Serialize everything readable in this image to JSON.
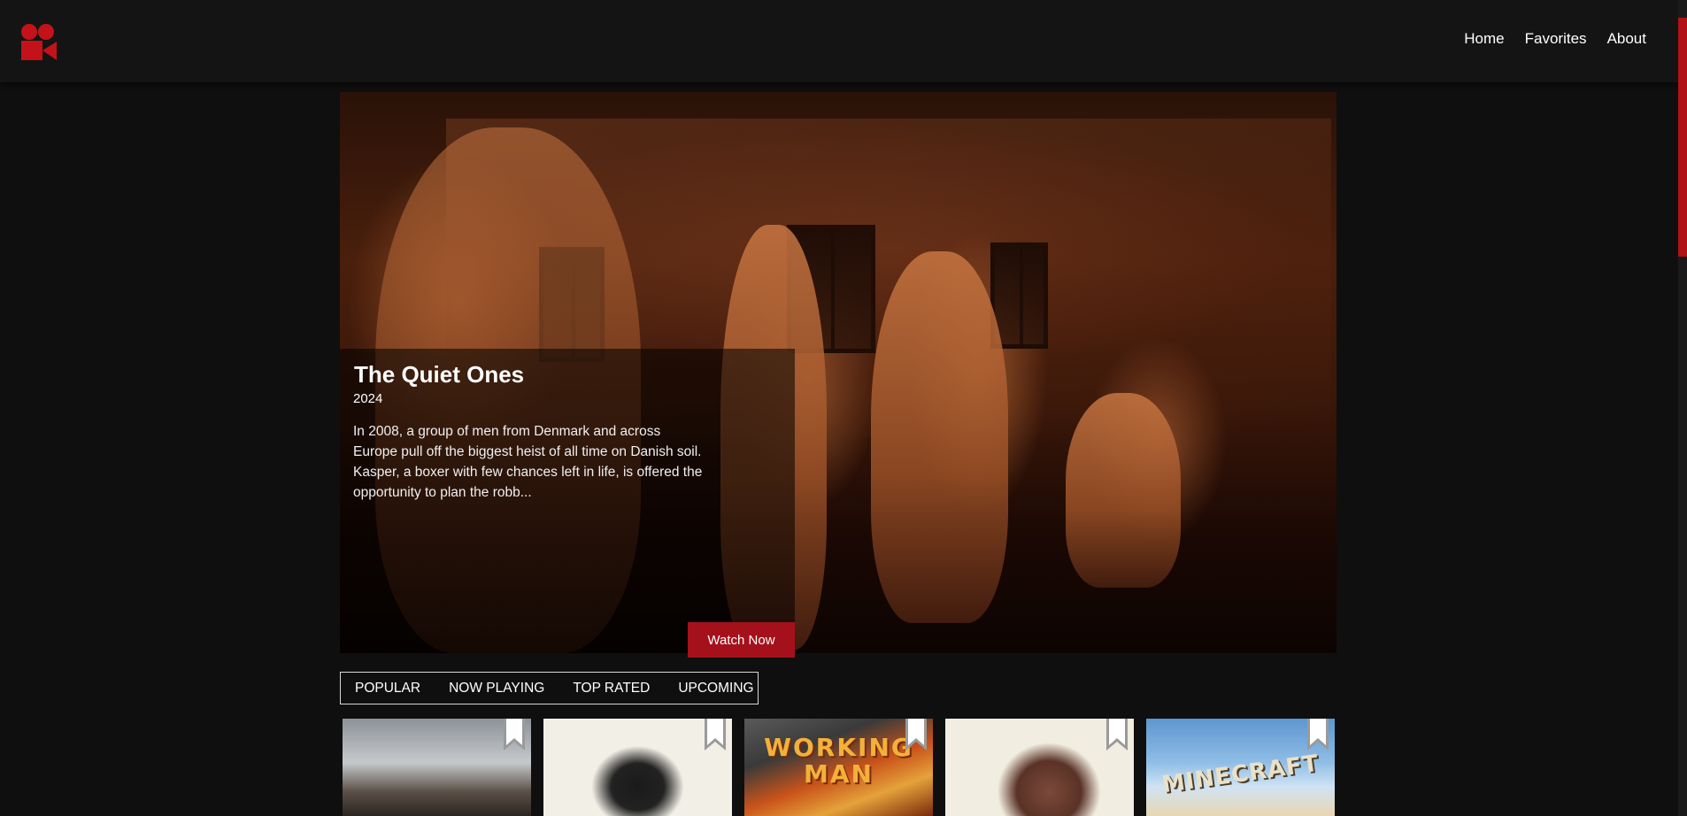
{
  "header": {
    "logo_icon": "film-camera-icon",
    "brand_color": "#c4121a",
    "nav": {
      "home": "Home",
      "favorites": "Favorites",
      "about": "About"
    }
  },
  "featured": {
    "title": "The Quiet Ones",
    "year": "2024",
    "description": "In 2008, a group of men from Denmark and across Europe pull off the biggest heist of all time on Danish soil. Kasper, a boxer with few chances left in life, is offered the opportunity to plan the robb...",
    "watch_label": "Watch Now",
    "accent_color": "#a5111b"
  },
  "tabs": [
    "POPULAR",
    "NOW PLAYING",
    "TOP RATED",
    "UPCOMING"
  ],
  "cards": [
    {
      "poster_text": "",
      "bookmark_icon": "bookmark-icon"
    },
    {
      "poster_text": "",
      "bookmark_icon": "bookmark-icon"
    },
    {
      "poster_text": "WORKING MAN",
      "bookmark_icon": "bookmark-icon"
    },
    {
      "poster_text": "",
      "bookmark_icon": "bookmark-icon"
    },
    {
      "poster_text": "MINECRAFT",
      "bookmark_icon": "bookmark-icon"
    }
  ]
}
